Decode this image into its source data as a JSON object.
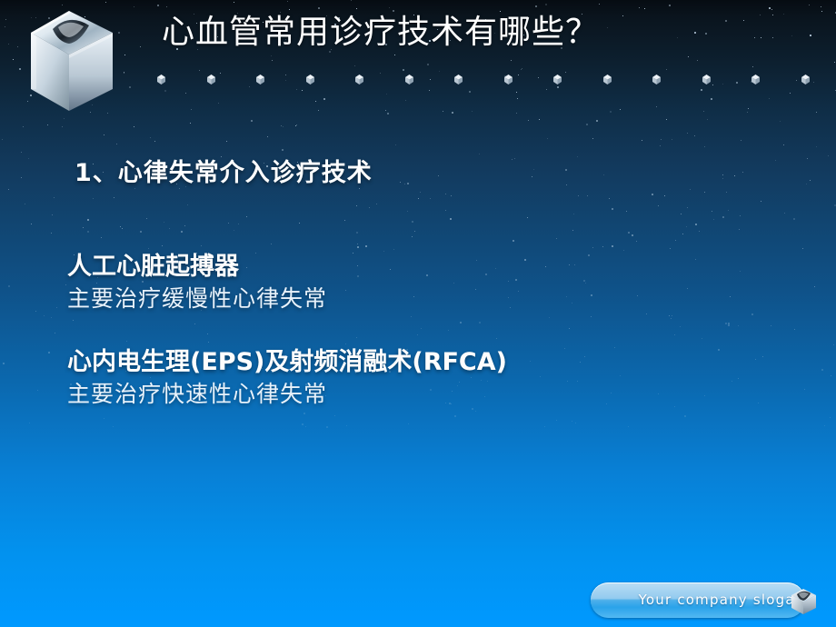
{
  "slide": {
    "title": "心血管常用诊疗技术有哪些？",
    "logo_icon": "metallic-cube-logo",
    "divider_glyph_icon": "small-cube-bullet-icon",
    "divider_glyph_count": 14,
    "section_number": "1、心律失常介入诊疗技术",
    "blocks": [
      {
        "heading": "人工心脏起搏器",
        "subtext": "主要治疗缓慢性心律失常"
      },
      {
        "heading": "心内电生理(EPS)及射频消融术(RFCA)",
        "subtext": "主要治疗快速性心律失常"
      }
    ]
  },
  "footer": {
    "slogan": "Your company  slogan",
    "icon": "metallic-cube-icon"
  },
  "colors": {
    "bg_top": "#060c12",
    "bg_mid": "#11446f",
    "bg_bottom": "#0099ff",
    "title_text": "#ffffff",
    "heading_text": "#fdfdfd",
    "sub_text": "#e8f2fb",
    "pill_accent": "#2aa3ea"
  }
}
